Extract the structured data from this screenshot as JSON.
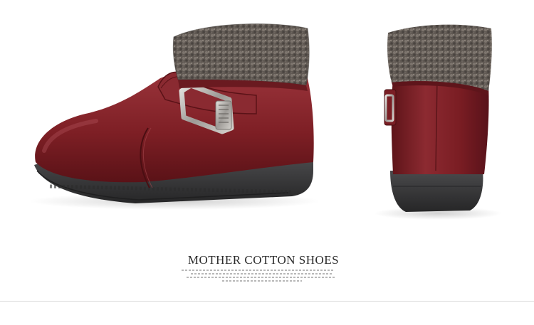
{
  "caption": {
    "title": "MOTHER COTTON SHOES"
  },
  "colors": {
    "leather": "#7e1f25",
    "leather_shadow": "#5a1217",
    "leather_highlight": "#a8434a",
    "fur": "#6e6660",
    "fur_dark": "#3f3a36",
    "sole": "#3a3a3c",
    "sole_dark": "#2a2a2b",
    "buckle": "#b9b6b2"
  },
  "icons": {
    "side_boot": "boot-side-view-image",
    "back_boot": "boot-back-view-image"
  }
}
